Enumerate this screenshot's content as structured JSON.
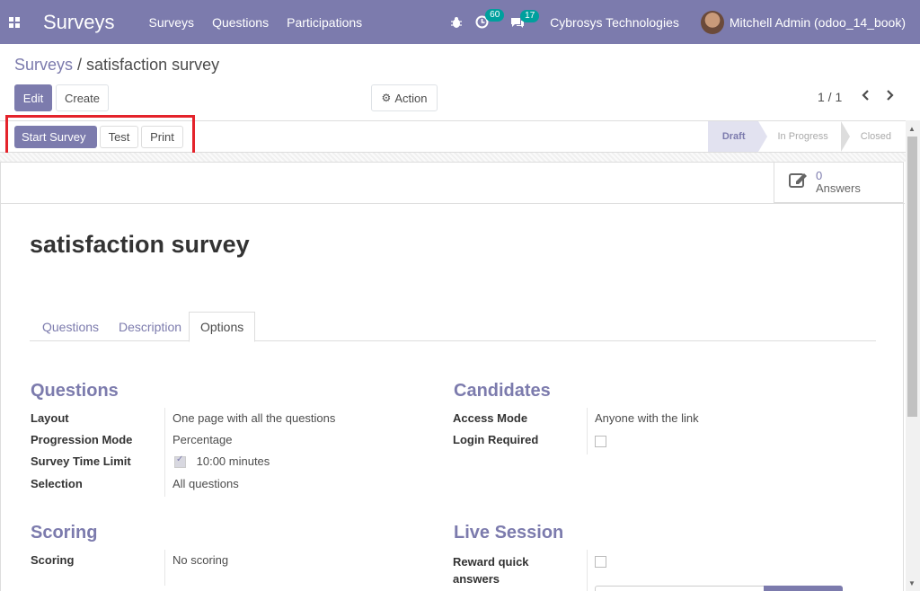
{
  "navbar": {
    "brand": "Surveys",
    "menu": [
      "Surveys",
      "Questions",
      "Participations"
    ],
    "activity_count": "60",
    "message_count": "17",
    "company": "Cybrosys Technologies",
    "user": "Mitchell Admin (odoo_14_book)"
  },
  "breadcrumb": {
    "parent": "Surveys",
    "separator": " / ",
    "current": "satisfaction survey"
  },
  "control": {
    "edit_label": "Edit",
    "create_label": "Create",
    "action_label": "Action",
    "pager": "1 / 1"
  },
  "statusbar": {
    "start_label": "Start Survey",
    "test_label": "Test",
    "print_label": "Print",
    "stages": [
      "Draft",
      "In Progress",
      "Closed"
    ],
    "active_stage": "Draft"
  },
  "stat_button": {
    "count": "0",
    "label": "Answers"
  },
  "form": {
    "title": "satisfaction survey",
    "tabs": [
      "Questions",
      "Description",
      "Options"
    ],
    "active_tab": "Options",
    "questions_section": {
      "title": "Questions",
      "fields": [
        {
          "label": "Layout",
          "value": "One page with all the questions"
        },
        {
          "label": "Progression Mode",
          "value": "Percentage"
        },
        {
          "label": "Survey Time Limit",
          "value": "10:00 minutes",
          "checked": true
        },
        {
          "label": "Selection",
          "value": "All questions"
        }
      ]
    },
    "candidates_section": {
      "title": "Candidates",
      "fields": [
        {
          "label": "Access Mode",
          "value": "Anyone with the link"
        },
        {
          "label": "Login Required",
          "checked": false
        }
      ]
    },
    "scoring_section": {
      "title": "Scoring",
      "fields": [
        {
          "label": "Scoring",
          "value": "No scoring"
        }
      ]
    },
    "live_section": {
      "title": "Live Session",
      "fields": [
        {
          "label": "Reward quick answers",
          "label_line1": "Reward quick",
          "label_line2": "answers",
          "checked": false
        }
      ]
    }
  },
  "colors": {
    "brand": "#7c7bad",
    "highlight": "#e4232b",
    "badge": "#00a09d"
  }
}
